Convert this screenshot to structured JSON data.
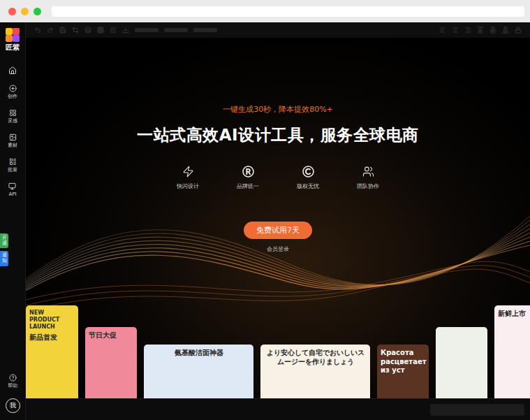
{
  "window_controls": [
    {
      "color": "#ff5f57"
    },
    {
      "color": "#febc2e"
    },
    {
      "color": "#28c840"
    }
  ],
  "sidebar": {
    "logo": "匠紫",
    "items": [
      {
        "label": "创作",
        "selected": false
      },
      {
        "label": "灵感",
        "selected": false
      },
      {
        "label": "素材",
        "selected": false
      },
      {
        "label": "批量",
        "selected": false
      },
      {
        "label": "API",
        "selected": false
      }
    ],
    "side_tabs": [
      {
        "label": "开通",
        "color": "#3aa757"
      },
      {
        "label": "通知",
        "color": "#2b7de0"
      }
    ],
    "help": "帮助",
    "avatar": "我"
  },
  "hero": {
    "tagline": "一键生成30秒，降本提效80%+",
    "title": "一站式高效AI设计工具，服务全球电商",
    "features": [
      {
        "label": "快闪设计"
      },
      {
        "label": "品牌统一"
      },
      {
        "label": "版权无忧"
      },
      {
        "label": "团队协作"
      }
    ],
    "cta": "免费试用7天",
    "login": "会员登录"
  },
  "showcase": [
    {
      "kind": "tall",
      "color": "#f2d43a",
      "lines": [
        "NEW PRODUCT LAUNCH",
        "新品首发"
      ]
    },
    {
      "kind": "mid",
      "color": "#f08a9a",
      "lines": [
        "节日大促"
      ]
    },
    {
      "kind": "wide",
      "color": "#dfe9f5",
      "lines": [
        "氨基酸洁面神器"
      ]
    },
    {
      "kind": "wide",
      "color": "#f7f1e6",
      "lines": [
        "より安心して自宅でおいしいスムージーを作りましょう"
      ]
    },
    {
      "kind": "narrow",
      "color": "#5a3322",
      "lines": [
        "Красота расцветает из уст"
      ]
    },
    {
      "kind": "mid",
      "color": "#eef0ea",
      "lines": []
    },
    {
      "kind": "tall",
      "color": "#fbeef0",
      "lines": [
        "新鲜上市"
      ]
    }
  ]
}
